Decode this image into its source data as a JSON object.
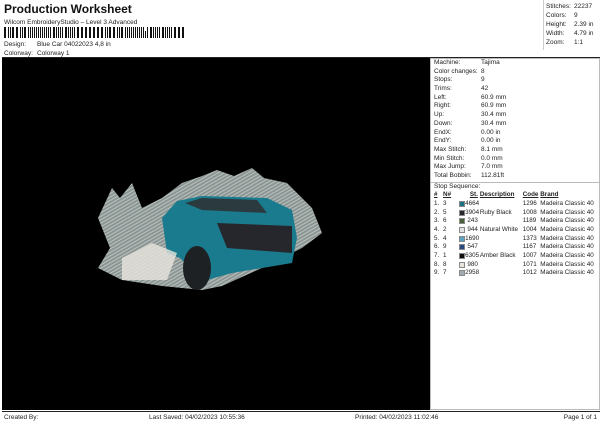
{
  "header": {
    "title": "Production Worksheet",
    "subtitle": "Wilcom EmbroideryStudio – Level 3 Advanced",
    "design_label": "Design:",
    "design_value": "Blue Car 04022023 4,8 in",
    "colorway_label": "Colorway:",
    "colorway_value": "Colorway 1"
  },
  "stats": [
    {
      "label": "Stitches:",
      "value": "22237"
    },
    {
      "label": "Colors:",
      "value": "9"
    },
    {
      "label": "Height:",
      "value": "2.39 in"
    },
    {
      "label": "Width:",
      "value": "4.79 in"
    },
    {
      "label": "Zoom:",
      "value": "1:1"
    }
  ],
  "details": [
    {
      "label": "Machine:",
      "value": "Tajima"
    },
    {
      "label": "Color changes:",
      "value": "8"
    },
    {
      "label": "Stops:",
      "value": "9"
    },
    {
      "label": "Trims:",
      "value": "42"
    },
    {
      "label": "Left:",
      "value": "60.9 mm"
    },
    {
      "label": "Right:",
      "value": "60.9 mm"
    },
    {
      "label": "Up:",
      "value": "30.4 mm"
    },
    {
      "label": "Down:",
      "value": "30.4 mm"
    },
    {
      "label": "EndX:",
      "value": "0.00 in"
    },
    {
      "label": "EndY:",
      "value": "0.00 in"
    },
    {
      "label": "Max Stitch:",
      "value": "8.1 mm"
    },
    {
      "label": "Min Stitch:",
      "value": "0.0 mm"
    },
    {
      "label": "Max Jump:",
      "value": "7.0 mm"
    },
    {
      "label": "Total Bobbin:",
      "value": "112.81ft"
    }
  ],
  "stop_sequence": {
    "title": "Stop Sequence:",
    "columns": [
      "#",
      "N#",
      "St.",
      "Description",
      "Code",
      "Brand"
    ],
    "rows": [
      {
        "n": "1.",
        "needle": "3",
        "color": "#1b7083",
        "stitches": "4664",
        "desc": "",
        "code": "1296",
        "brand": "Madeira Classic 40"
      },
      {
        "n": "2.",
        "needle": "5",
        "color": "#26272c",
        "stitches": "3904",
        "desc": "Ruby Black",
        "code": "1008",
        "brand": "Madeira Classic 40"
      },
      {
        "n": "3.",
        "needle": "6",
        "color": "#4b5e3b",
        "stitches": "243",
        "desc": "",
        "code": "1189",
        "brand": "Madeira Classic 40"
      },
      {
        "n": "4.",
        "needle": "2",
        "color": "#e2e2e4",
        "stitches": "944",
        "desc": "Natural White",
        "code": "1004",
        "brand": "Madeira Classic 40"
      },
      {
        "n": "5.",
        "needle": "4",
        "color": "#5ea3c2",
        "stitches": "1690",
        "desc": "",
        "code": "1373",
        "brand": "Madeira Classic 40"
      },
      {
        "n": "6.",
        "needle": "9",
        "color": "#284a82",
        "stitches": "547",
        "desc": "",
        "code": "1167",
        "brand": "Madeira Classic 40"
      },
      {
        "n": "7.",
        "needle": "1",
        "color": "#0e0e0e",
        "stitches": "6305",
        "desc": "Amber Black",
        "code": "1007",
        "brand": "Madeira Classic 40"
      },
      {
        "n": "8.",
        "needle": "8",
        "color": "#e9e5dd",
        "stitches": "980",
        "desc": "",
        "code": "1071",
        "brand": "Madeira Classic 40"
      },
      {
        "n": "9.",
        "needle": "7",
        "color": "#a2abb0",
        "stitches": "2958",
        "desc": "",
        "code": "1012",
        "brand": "Madeira Classic 40"
      }
    ]
  },
  "footer": {
    "created_by": "Created By:",
    "last_saved": "Last Saved: 04/02/2023 10:55:36",
    "printed": "Printed: 04/02/2023 11:02:46",
    "page": "Page 1 of 1"
  }
}
